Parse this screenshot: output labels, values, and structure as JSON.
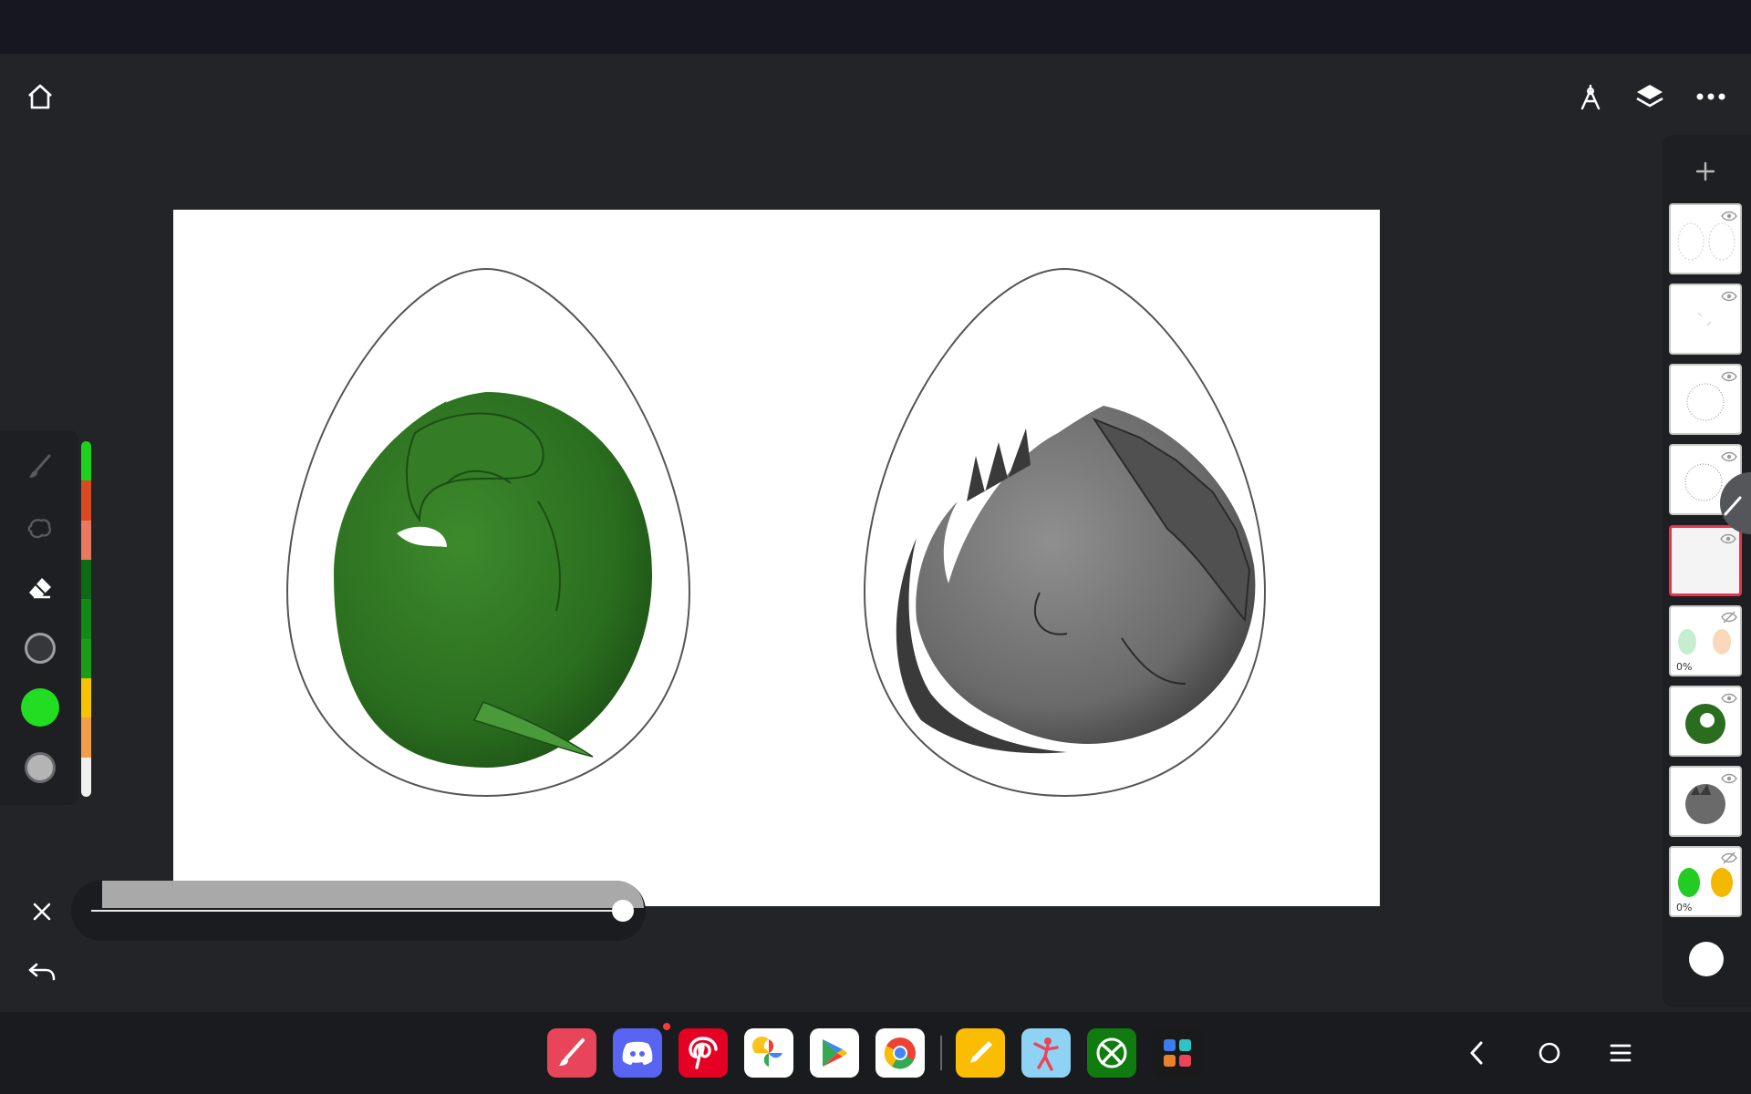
{
  "app": {
    "accent": "#e8344c",
    "toolbar": {
      "home_icon": "home-icon",
      "right_icons": [
        "ruler-compass-icon",
        "layers-icon",
        "more-icon"
      ]
    }
  },
  "tools": {
    "items": [
      "brush-icon",
      "smudge-icon",
      "eraser-icon",
      "brush-size-icon",
      "color-swatch-icon",
      "opacity-icon"
    ],
    "current_color": "#22dd22",
    "palette": [
      "#1fd11f",
      "#d94a22",
      "#e8795f",
      "#0d6b15",
      "#138a15",
      "#1a9e1a",
      "#f5c400",
      "#f09e4a",
      "#f0f0f0"
    ]
  },
  "size_slider": {
    "value_fraction": 1.0
  },
  "canvas": {
    "background": "#ffffff",
    "artworks": [
      "green-dragon-egg",
      "grey-dragon-egg"
    ]
  },
  "layers": {
    "add_icon": "plus-icon",
    "items": [
      {
        "name": "layer-egg-outline",
        "visible": true,
        "opacity_label": ""
      },
      {
        "name": "layer-sketch-1",
        "visible": true,
        "opacity_label": ""
      },
      {
        "name": "layer-sketch-2",
        "visible": true,
        "opacity_label": ""
      },
      {
        "name": "layer-sketch-3",
        "visible": true,
        "opacity_label": ""
      },
      {
        "name": "layer-empty-selected",
        "visible": true,
        "opacity_label": ""
      },
      {
        "name": "layer-color-eggs",
        "visible": false,
        "opacity_label": "0%"
      },
      {
        "name": "layer-green-dragon",
        "visible": true,
        "opacity_label": ""
      },
      {
        "name": "layer-grey-dragon",
        "visible": true,
        "opacity_label": ""
      },
      {
        "name": "layer-egg-fills",
        "visible": false,
        "opacity_label": "0%"
      }
    ]
  },
  "bottom_left": [
    "close-icon",
    "undo-icon"
  ],
  "taskbar": {
    "apps": [
      "sketch-app-icon",
      "discord-icon",
      "pinterest-icon",
      "google-photos-icon",
      "play-store-icon",
      "chrome-icon",
      "notes-icon",
      "dance-app-icon",
      "xbox-icon",
      "app-drawer-icon"
    ],
    "nav": [
      "back-icon",
      "home-nav-icon",
      "recents-icon"
    ]
  }
}
